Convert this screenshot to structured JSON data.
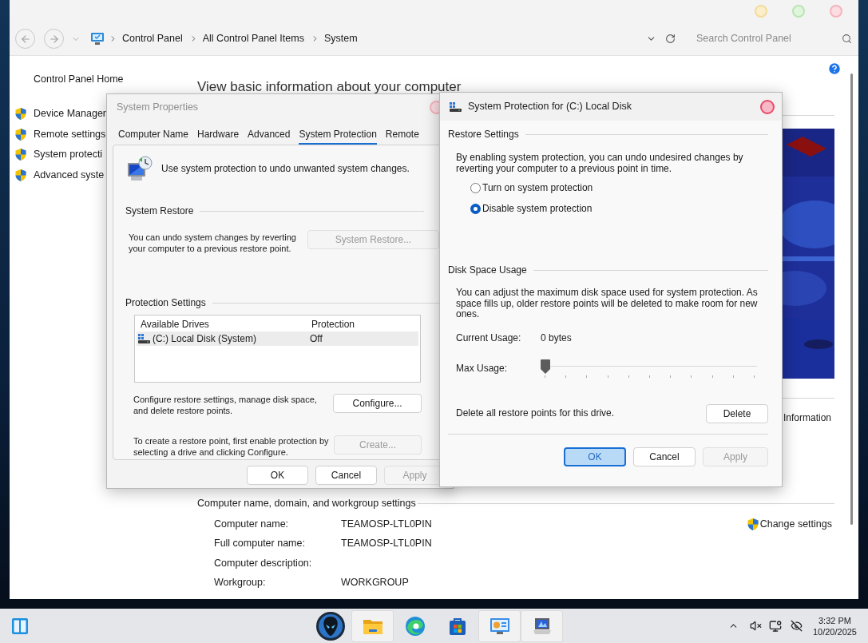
{
  "address_bar": {
    "breadcrumbs": [
      "Control Panel",
      "All Control Panel Items",
      "System"
    ],
    "search": {
      "placeholder": "Search Control Panel"
    }
  },
  "sidebar": {
    "home": "Control Panel Home",
    "items": [
      "Device Manager",
      "Remote settings",
      "System protecti",
      "Advanced syste"
    ]
  },
  "main": {
    "heading": "View basic information about your computer",
    "side_link": "Information",
    "section": {
      "title": "Computer name, domain, and workgroup settings",
      "action": "Change settings",
      "rows": [
        {
          "label": "Computer name:",
          "value": "TEAMOSP-LTL0PIN"
        },
        {
          "label": "Full computer name:",
          "value": "TEAMOSP-LTL0PIN"
        },
        {
          "label": "Computer description:"
        },
        {
          "label": "Workgroup:",
          "value": "WORKGROUP"
        }
      ]
    }
  },
  "system_properties": {
    "title": "System Properties",
    "active": false,
    "tabs": [
      {
        "label": "Computer Name",
        "selected": false
      },
      {
        "label": "Hardware",
        "selected": false
      },
      {
        "label": "Advanced",
        "selected": false
      },
      {
        "label": "System Protection",
        "selected": true
      },
      {
        "label": "Remote",
        "selected": false
      }
    ],
    "intro": "Use system protection to undo unwanted system changes.",
    "system_restore": {
      "title": "System Restore",
      "text": "You can undo system changes by reverting your computer to a previous restore point.",
      "button": {
        "label": "System Restore...",
        "disabled": true
      }
    },
    "protection_settings": {
      "title": "Protection Settings",
      "columns": [
        "Available Drives",
        "Protection"
      ],
      "drives": [
        {
          "name": "(C:) Local Disk (System)",
          "protection": "Off",
          "selected": true
        }
      ],
      "configure": {
        "text": "Configure restore settings, manage disk space, and delete restore points.",
        "button": {
          "label": "Configure...",
          "disabled": false
        }
      },
      "create": {
        "text": "To create a restore point, first enable protection by selecting a drive and clicking Configure.",
        "button": {
          "label": "Create...",
          "disabled": true
        }
      }
    },
    "buttons": [
      {
        "label": "OK",
        "disabled": false
      },
      {
        "label": "Cancel",
        "disabled": false
      },
      {
        "label": "Apply",
        "disabled": true
      }
    ]
  },
  "protection_dialog": {
    "title": "System Protection for (C:) Local Disk",
    "active": true,
    "restore_settings": {
      "title": "Restore Settings",
      "text": "By enabling system protection, you can undo undesired changes by reverting your computer to a previous point in time.",
      "options": [
        {
          "label": "Turn on system protection",
          "selected": false
        },
        {
          "label": "Disable system protection",
          "selected": true
        }
      ]
    },
    "disk_space": {
      "title": "Disk Space Usage",
      "text": "You can adjust the maximum disk space used for system protection. As space fills up, older restore points will be deleted to make room for new ones.",
      "current_label": "Current Usage:",
      "current_value": "0 bytes",
      "max_label": "Max Usage:",
      "max_usage": {
        "level": 0
      }
    },
    "delete": {
      "text": "Delete all restore points for this drive.",
      "button": "Delete"
    },
    "buttons": [
      {
        "label": "OK",
        "default": true,
        "disabled": false
      },
      {
        "label": "Cancel",
        "default": false,
        "disabled": false
      },
      {
        "label": "Apply",
        "default": false,
        "disabled": true
      }
    ]
  },
  "taskbar": {
    "apps": [
      {
        "kind": "alien",
        "open": false
      },
      {
        "kind": "folder",
        "open": true
      },
      {
        "kind": "edge",
        "open": false
      },
      {
        "kind": "store",
        "open": false
      },
      {
        "kind": "control_panel",
        "open": true
      },
      {
        "kind": "system",
        "open": true
      }
    ],
    "clock": {
      "time": "3:32 PM",
      "date": "10/20/2025"
    }
  }
}
